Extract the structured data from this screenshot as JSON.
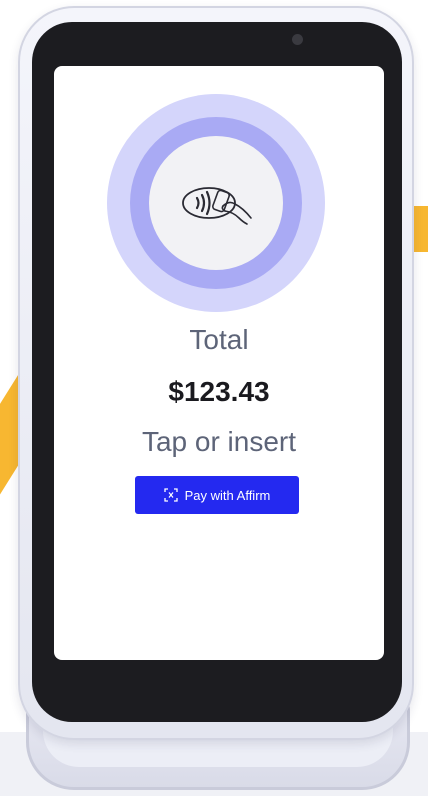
{
  "screen": {
    "total_label": "Total",
    "amount": "$123.43",
    "instruction": "Tap or insert",
    "affirm_button_label": "Pay with Affirm"
  },
  "icons": {
    "contactless": "contactless-tap-icon",
    "affirm_scan": "scan-qr-icon",
    "camera": "camera-icon"
  },
  "colors": {
    "button": "#2429f0",
    "ring_outer": "#d4d5fb",
    "ring_mid": "#a9aaf4",
    "accent": "#f7b731",
    "label_text": "#5d6478",
    "amount_text": "#1a1a1f"
  }
}
